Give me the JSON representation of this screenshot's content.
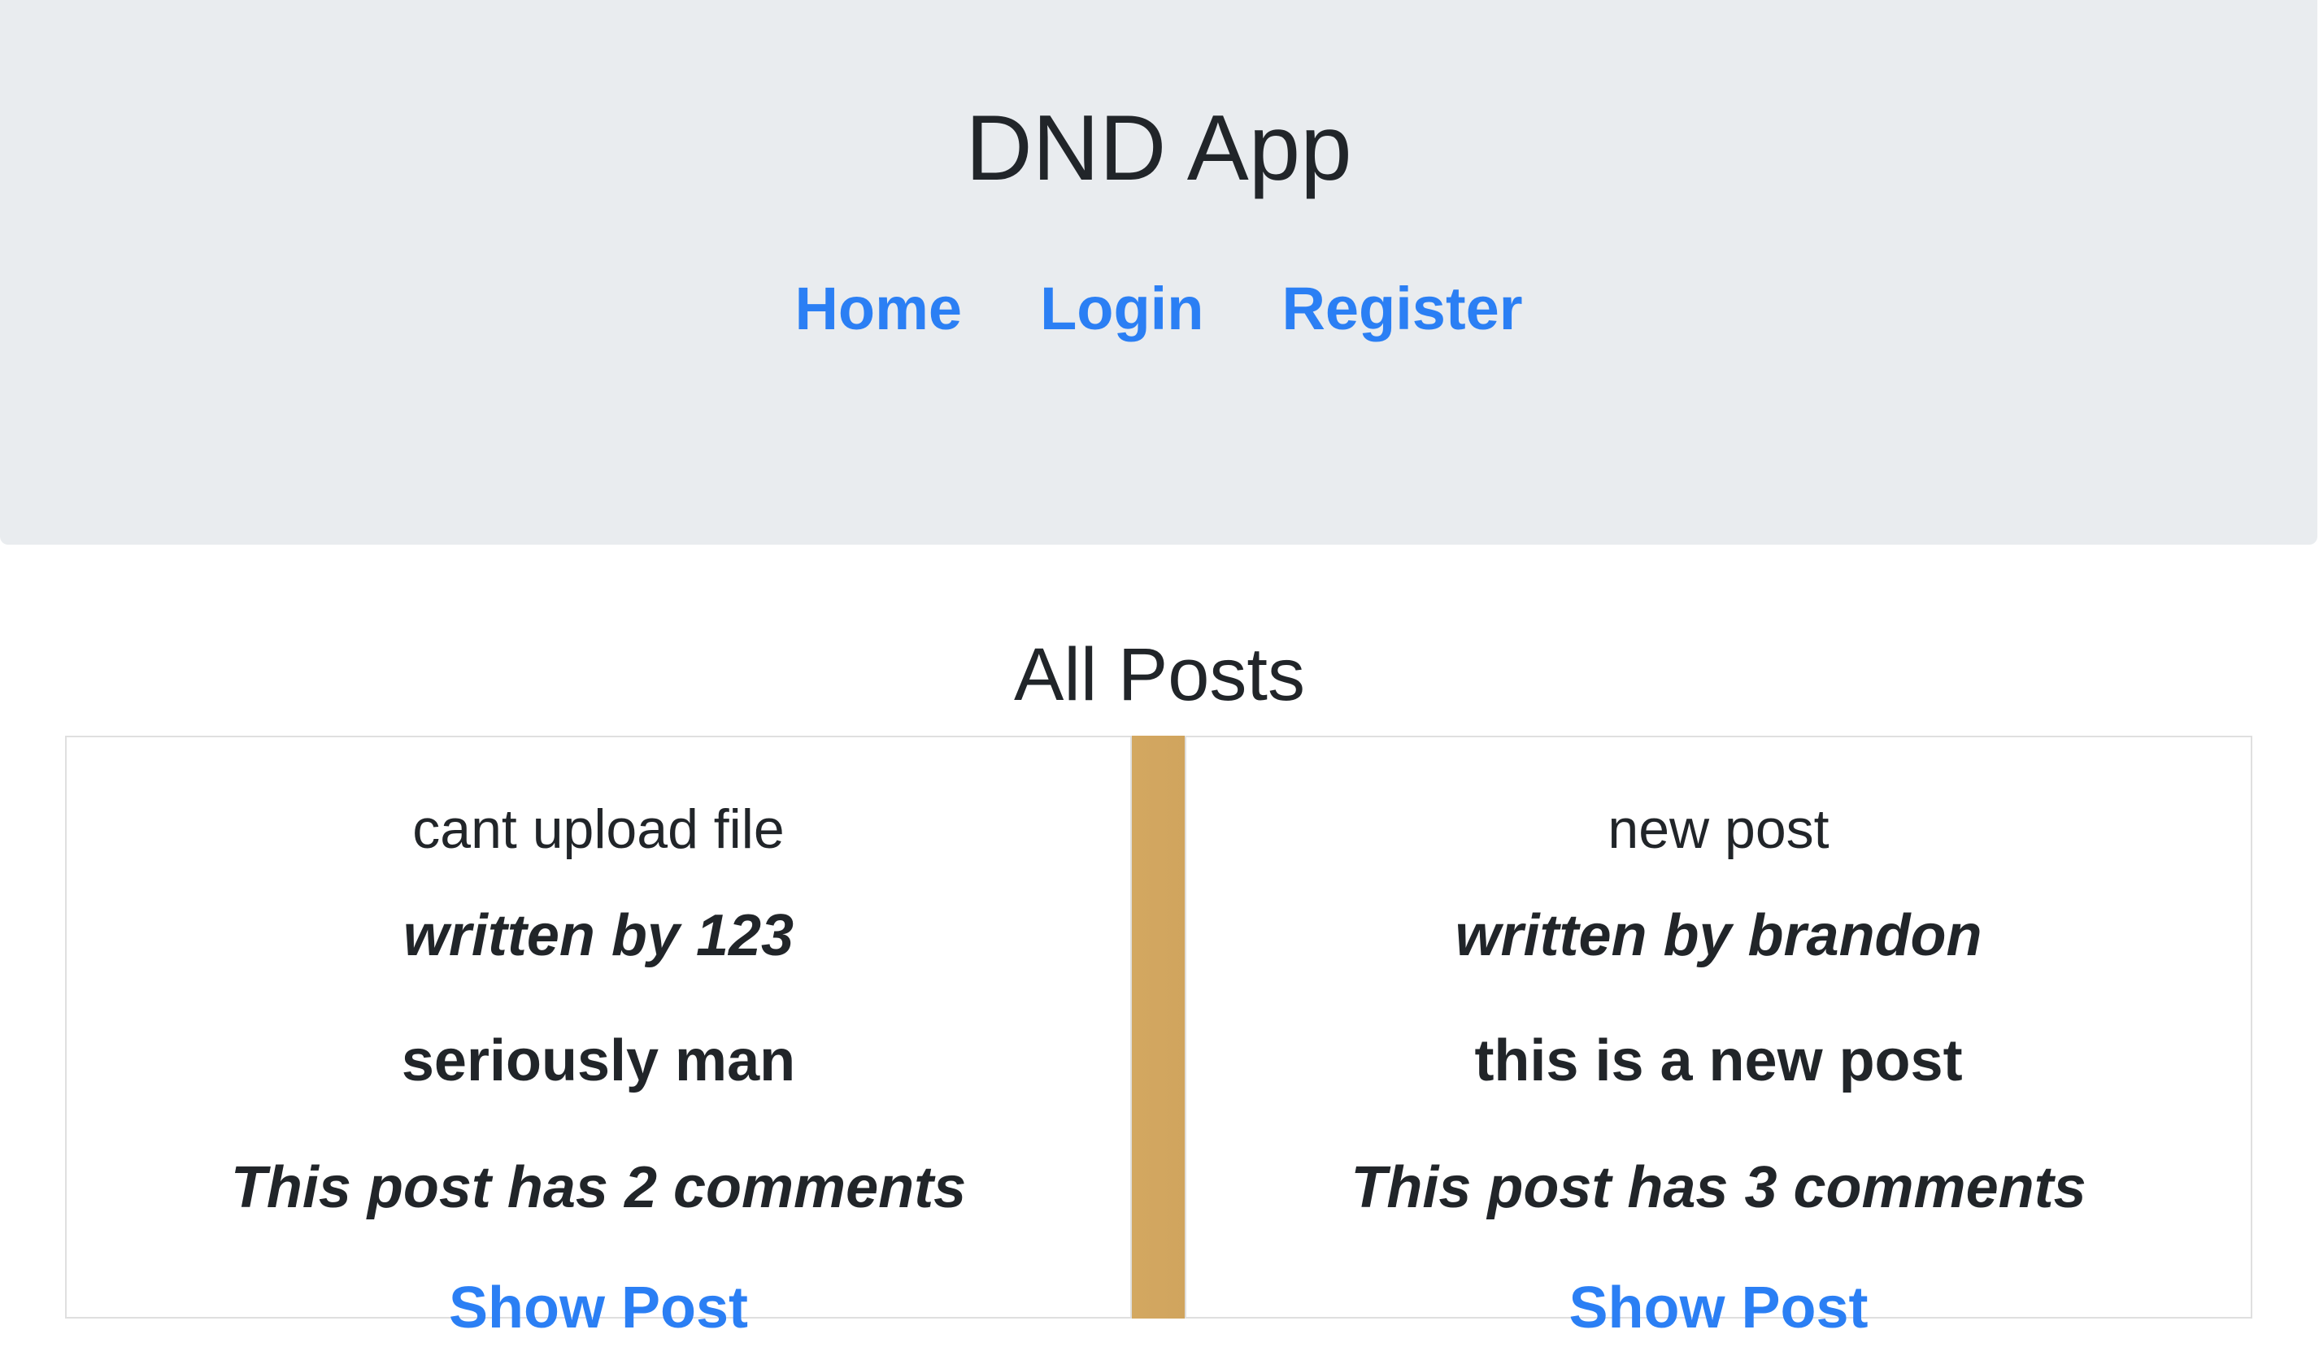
{
  "header": {
    "title": "DND App",
    "nav": [
      {
        "label": "Home"
      },
      {
        "label": "Login"
      },
      {
        "label": "Register"
      }
    ]
  },
  "main": {
    "section_title": "All Posts",
    "posts": [
      {
        "title": "cant upload file",
        "author": "written by 123",
        "body": "seriously man",
        "comments": "This post has 2 comments",
        "link_label": "Show Post"
      },
      {
        "title": "new post",
        "author": "written by brandon",
        "body": "this is a new post",
        "comments": "This post has 3 comments",
        "link_label": "Show Post"
      }
    ]
  },
  "colors": {
    "link": "#2b7ff4",
    "jumbotron_bg": "#e9ecef",
    "text": "#212529"
  }
}
